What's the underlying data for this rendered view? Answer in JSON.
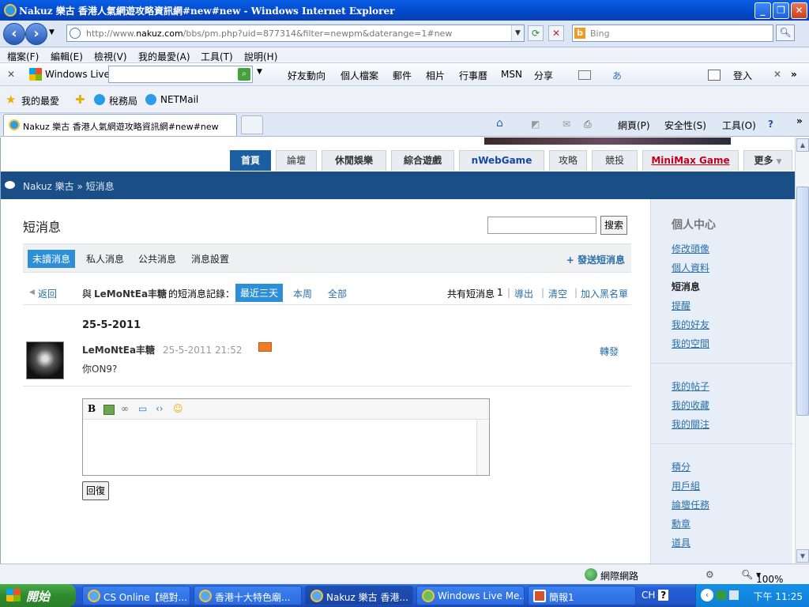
{
  "window": {
    "title": "Nakuz 樂古 香港人氣網遊攻略資訊網#new#new - Windows Internet Explorer",
    "url_prefix": "http://www.",
    "url_domain": "nakuz.com",
    "url_path": "/bbs/pm.php?uid=877314&filter=newpm&daterange=1#new",
    "search_placeholder": "Bing",
    "minimize": "_",
    "restore": "❐",
    "close": "✕"
  },
  "menu": [
    "檔案(F)",
    "編輯(E)",
    "檢視(V)",
    "我的最愛(A)",
    "工具(T)",
    "說明(H)"
  ],
  "live_toolbar": {
    "brand": "Windows Live",
    "items": [
      "好友動向",
      "個人檔案",
      "郵件",
      "相片",
      "行事曆",
      "MSN",
      "分享"
    ],
    "signin": "登入"
  },
  "favorites": {
    "label": "我的最愛",
    "links": [
      "稅務局",
      "NETMail"
    ]
  },
  "tab": {
    "title": "Nakuz 樂古 香港人氣網遊攻略資訊網#new#new",
    "cmd_page": "網頁(P)",
    "cmd_safety": "安全性(S)",
    "cmd_tools": "工具(O)"
  },
  "site_nav": [
    "首頁",
    "論壇",
    "休閒娛樂",
    "綜合遊戲",
    "nWebGame",
    "攻略",
    "競投",
    "MiniMax Game",
    "更多"
  ],
  "site_nav_colors": {
    "nWebGame": "#1747a6",
    "MiniMax Game": "#c4001f"
  },
  "breadcrumb": "Nakuz 樂古 » 短消息",
  "pm": {
    "title": "短消息",
    "search_button": "搜索",
    "tabs": [
      "未讀消息",
      "私人消息",
      "公共消息",
      "消息設置"
    ],
    "send_link": "+ 發送短消息",
    "back": "返回",
    "with_prefix": "與",
    "with_user": "LeMoNtEa丰糖",
    "with_suffix": "的短消息記錄：",
    "ranges": [
      "最近三天",
      "本周",
      "全部"
    ],
    "count_label": "共有短消息",
    "count": "1",
    "actions": [
      "導出",
      "清空",
      "加入黑名單"
    ],
    "date": "25-5-2011",
    "message": {
      "sender": "LeMoNtEa丰糖",
      "time": "25-5-2011 21:52",
      "text": "你ON9?",
      "forward": "轉發"
    },
    "editor_tools": [
      "B",
      "image-icon",
      "link-icon",
      "quote-icon",
      "code-icon",
      "smiley-icon"
    ],
    "reply_button": "回復"
  },
  "sidebar": {
    "heading": "個人中心",
    "group1": [
      "修改頭像",
      "個人資料",
      "短消息",
      "提醒",
      "我的好友",
      "我的空間"
    ],
    "current": "短消息",
    "group2": [
      "我的帖子",
      "我的收藏",
      "我的關注"
    ],
    "group3": [
      "積分",
      "用戶組",
      "論壇任務",
      "勳章",
      "道具"
    ]
  },
  "status": {
    "zone": "網際網路",
    "zoom": "100%"
  },
  "taskbar": {
    "start": "開始",
    "tasks": [
      "CS Online【絕對...",
      "香港十大特色廟...",
      "Nakuz 樂古 香港...",
      "Windows Live Me...",
      "簡報1"
    ],
    "lang": "CH",
    "clock": "下午 11:25"
  }
}
